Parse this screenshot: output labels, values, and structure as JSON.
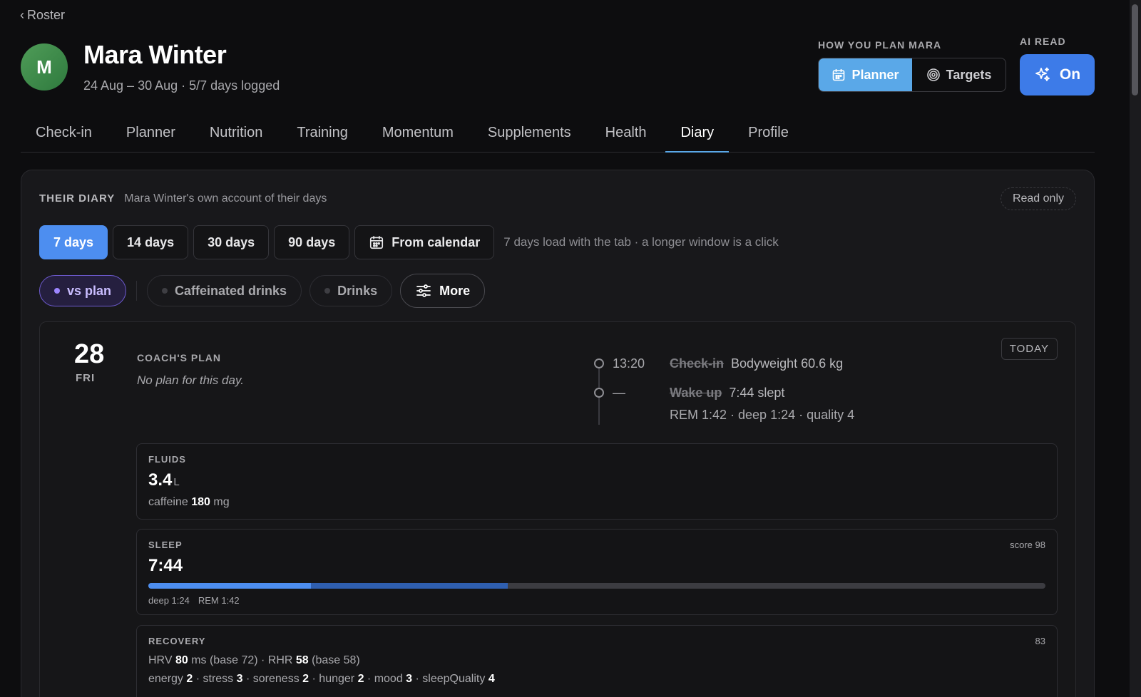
{
  "nav": {
    "back_label": "Roster"
  },
  "client": {
    "initial": "M",
    "avatar_color": "#3f8c4c",
    "name": "Mara Winter",
    "subtitle": "24 Aug – 30 Aug · 5/7 days logged"
  },
  "planning": {
    "label": "HOW YOU PLAN MARA",
    "options": [
      {
        "label": "Planner",
        "icon": "calendar-icon",
        "selected": true
      },
      {
        "label": "Targets",
        "icon": "target-icon",
        "selected": false
      }
    ],
    "active_color": "#5aa8e8"
  },
  "ai_read": {
    "label": "AI READ",
    "state": "On",
    "icon": "sparkle-icon",
    "color": "#3d7be8"
  },
  "tabs": [
    "Check-in",
    "Planner",
    "Nutrition",
    "Training",
    "Momentum",
    "Supplements",
    "Health",
    "Diary",
    "Profile"
  ],
  "active_tab": "Diary",
  "diary": {
    "title": "THEIR DIARY",
    "subtitle": "Mara Winter's own account of their days",
    "read_only": "Read only",
    "ranges": [
      "7 days",
      "14 days",
      "30 days",
      "90 days"
    ],
    "selected_range": "7 days",
    "calendar_label": "From calendar",
    "range_hint": "7 days load with the tab · a longer window is a click",
    "filters": [
      {
        "label": "vs plan",
        "active": true
      },
      {
        "label": "Caffeinated drinks",
        "active": false
      },
      {
        "label": "Drinks",
        "active": false
      }
    ],
    "more_label": "More"
  },
  "day": {
    "number": "28",
    "weekday": "FRI",
    "today_tag": "TODAY",
    "coach_plan_label": "COACH'S PLAN",
    "coach_plan_note": "No plan for this day.",
    "timeline": [
      {
        "time": "13:20",
        "title": "Check-in",
        "detail": "Bodyweight 60.6 kg",
        "sub": ""
      },
      {
        "time": "—",
        "title": "Wake up",
        "detail": "7:44 slept",
        "sub": "REM 1:42 · deep 1:24 · quality 4"
      }
    ],
    "fluids": {
      "label": "FLUIDS",
      "value": "3.4",
      "unit": "L",
      "caffeine_prefix": "caffeine",
      "caffeine_value": "180",
      "caffeine_unit": "mg"
    },
    "sleep": {
      "label": "SLEEP",
      "score": "score 98",
      "value": "7:44",
      "deep": "deep 1:24",
      "rem": "REM 1:42",
      "deep_fraction": 0.181,
      "rem_fraction": 0.22,
      "deep_color": "#4d8ef0",
      "rem_color": "#2f5fb0"
    },
    "recovery": {
      "label": "RECOVERY",
      "score": "83",
      "hrv_label": "HRV",
      "hrv_value": "80",
      "hrv_rest": "ms (base 72) · RHR",
      "rhr_value": "58",
      "rhr_rest": "(base 58)",
      "energy_label": "energy",
      "energy": "2",
      "stress_label": "· stress",
      "stress": "3",
      "soreness_label": "· soreness",
      "soreness": "2",
      "hunger_label": "· hunger",
      "hunger": "2",
      "mood_label": "· mood",
      "mood": "3",
      "sleepq_label": "· sleepQuality",
      "sleepq": "4"
    }
  }
}
